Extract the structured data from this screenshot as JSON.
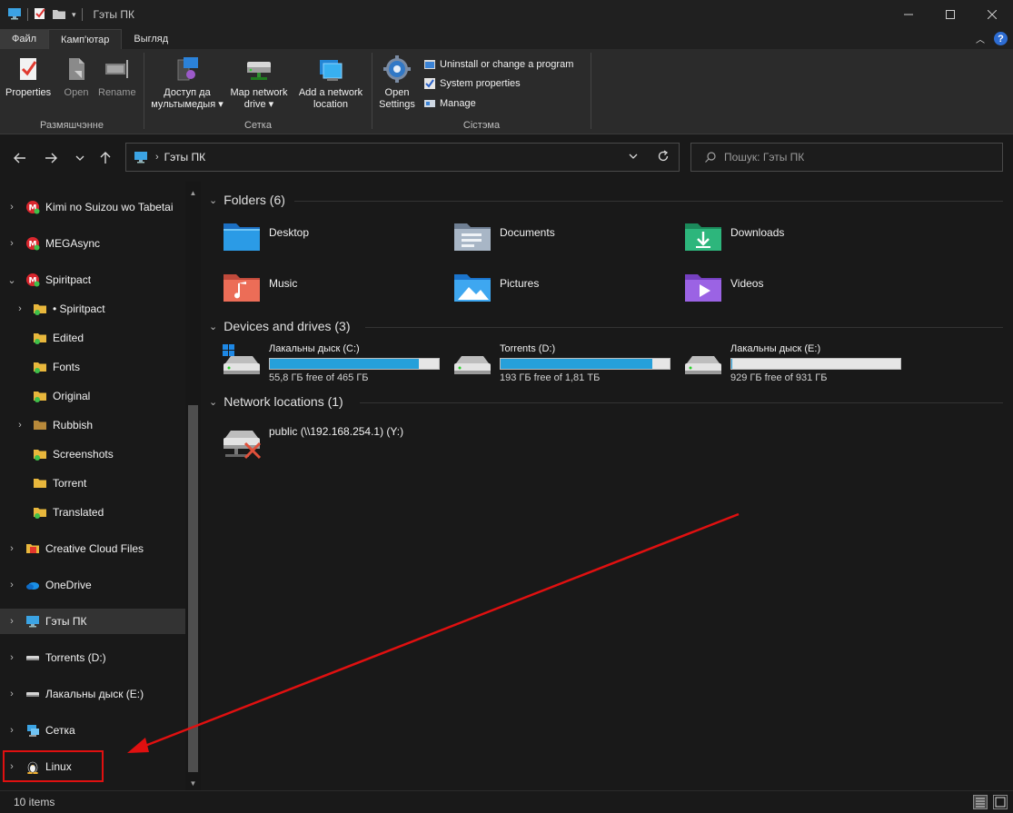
{
  "window": {
    "title": "Гэты ПК"
  },
  "ribbon_tabs": [
    {
      "label": "Файл"
    },
    {
      "label": "Камп'ютар"
    },
    {
      "label": "Выгляд"
    }
  ],
  "ribbon": {
    "location_group": {
      "label": "Размяшчэнне",
      "properties": "Properties",
      "open": "Open",
      "rename": "Rename"
    },
    "network_group": {
      "label": "Сетка",
      "media_line1": "Доступ да",
      "media_line2": "мультымедыя",
      "map_line1": "Map network",
      "map_line2": "drive",
      "add_line1": "Add a network",
      "add_line2": "location"
    },
    "system_group": {
      "label": "Сістэма",
      "settings_line1": "Open",
      "settings_line2": "Settings",
      "uninstall": "Uninstall or change a program",
      "system_properties": "System properties",
      "manage": "Manage"
    }
  },
  "address": {
    "path": "Гэты ПК",
    "search_placeholder": "Пошук: Гэты ПК"
  },
  "nav_items": [
    {
      "label": "Kimi no Suizou wo Tabetai"
    },
    {
      "label": "MEGAsync"
    },
    {
      "label": "Spiritpact"
    },
    {
      "label": "• Spiritpact"
    },
    {
      "label": "Edited"
    },
    {
      "label": "Fonts"
    },
    {
      "label": "Original"
    },
    {
      "label": "Rubbish"
    },
    {
      "label": "Screenshots"
    },
    {
      "label": "Torrent"
    },
    {
      "label": "Translated"
    },
    {
      "label": "Creative Cloud Files"
    },
    {
      "label": "OneDrive"
    },
    {
      "label": "Гэты ПК"
    },
    {
      "label": "Torrents (D:)"
    },
    {
      "label": "Лакальны дыск (E:)"
    },
    {
      "label": "Сетка"
    },
    {
      "label": "Linux"
    }
  ],
  "sections": {
    "folders": "Folders (6)",
    "drives": "Devices and drives (3)",
    "network": "Network locations (1)"
  },
  "folders": [
    {
      "label": "Desktop"
    },
    {
      "label": "Documents"
    },
    {
      "label": "Downloads"
    },
    {
      "label": "Music"
    },
    {
      "label": "Pictures"
    },
    {
      "label": "Videos"
    }
  ],
  "drives": [
    {
      "label": "Лакальны дыск (C:)",
      "free": "55,8 ГБ free of 465 ГБ",
      "used_fraction": 0.88
    },
    {
      "label": "Torrents (D:)",
      "free": "193 ГБ free of 1,81 ТБ",
      "used_fraction": 0.9
    },
    {
      "label": "Лакальны дыск (E:)",
      "free": "929 ГБ free of 931 ГБ",
      "used_fraction": 0.002
    }
  ],
  "network_locations": [
    {
      "label": "public (\\\\192.168.254.1) (Y:)"
    }
  ],
  "status": {
    "items": "10 items"
  },
  "colors": {
    "drive_bar_fill": "#26a0da",
    "highlight": "#e01010",
    "accent": "#2d6cd2"
  }
}
